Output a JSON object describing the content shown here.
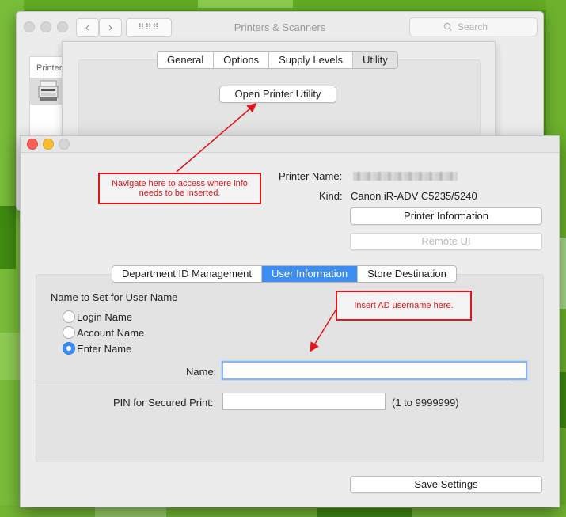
{
  "colors": {
    "accent": "#3d8ef3",
    "annotation": "#e0161c",
    "background": "#5aa51e"
  },
  "back_window": {
    "title": "Printers & Scanners",
    "search_placeholder": "Search",
    "printer_list_header": "Printer",
    "nav_back_glyph": "‹",
    "nav_forward_glyph": "›",
    "grid_glyph": "⠿⠿⠿"
  },
  "options_sheet": {
    "tabs": [
      {
        "label": "General"
      },
      {
        "label": "Options"
      },
      {
        "label": "Supply Levels"
      },
      {
        "label": "Utility"
      }
    ],
    "open_utility_label": "Open Printer Utility"
  },
  "utility_window": {
    "printer_name_label": "Printer Name:",
    "kind_label": "Kind:",
    "kind_value": "Canon iR-ADV C5235/5240",
    "printer_info_button": "Printer Information",
    "remote_ui_button": "Remote UI",
    "tabs": [
      {
        "label": "Department ID Management"
      },
      {
        "label": "User Information"
      },
      {
        "label": "Store Destination"
      }
    ],
    "section_title": "Name to Set for User Name",
    "radios": [
      {
        "label": "Login Name",
        "selected": false
      },
      {
        "label": "Account Name",
        "selected": false
      },
      {
        "label": "Enter Name",
        "selected": true
      }
    ],
    "name_label": "Name:",
    "name_value": "",
    "pin_label": "PIN for Secured Print:",
    "pin_value": "",
    "pin_range": "(1 to 9999999)",
    "save_button": "Save Settings"
  },
  "annotations": {
    "note1": "Navigate here to access where info needs to be inserted.",
    "note2": "Insert AD username here."
  }
}
